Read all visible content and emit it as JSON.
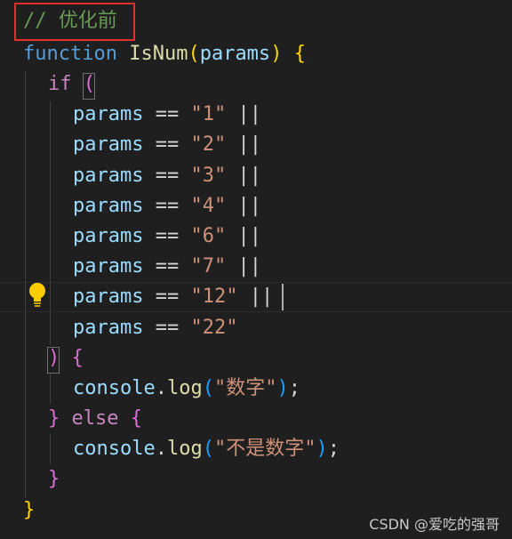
{
  "editor": {
    "lines": [
      {
        "segments": [
          [
            "cmt",
            "// 优化前"
          ]
        ]
      },
      {
        "segments": [
          [
            "kw",
            "function"
          ],
          [
            "op",
            " "
          ],
          [
            "fn",
            "IsNum"
          ],
          [
            "b1",
            "("
          ],
          [
            "var",
            "params"
          ],
          [
            "b1",
            ")"
          ],
          [
            "op",
            " "
          ],
          [
            "b1",
            "{"
          ]
        ]
      },
      {
        "segments": [
          [
            "ctl",
            "if"
          ],
          [
            "op",
            " "
          ],
          [
            "b2",
            "("
          ]
        ]
      },
      {
        "segments": [
          [
            "var",
            "params"
          ],
          [
            "op",
            " == "
          ],
          [
            "str",
            "\"1\""
          ],
          [
            "op",
            " ||"
          ]
        ]
      },
      {
        "segments": [
          [
            "var",
            "params"
          ],
          [
            "op",
            " == "
          ],
          [
            "str",
            "\"2\""
          ],
          [
            "op",
            " ||"
          ]
        ]
      },
      {
        "segments": [
          [
            "var",
            "params"
          ],
          [
            "op",
            " == "
          ],
          [
            "str",
            "\"3\""
          ],
          [
            "op",
            " ||"
          ]
        ]
      },
      {
        "segments": [
          [
            "var",
            "params"
          ],
          [
            "op",
            " == "
          ],
          [
            "str",
            "\"4\""
          ],
          [
            "op",
            " ||"
          ]
        ]
      },
      {
        "segments": [
          [
            "var",
            "params"
          ],
          [
            "op",
            " == "
          ],
          [
            "str",
            "\"6\""
          ],
          [
            "op",
            " ||"
          ]
        ]
      },
      {
        "segments": [
          [
            "var",
            "params"
          ],
          [
            "op",
            " == "
          ],
          [
            "str",
            "\"7\""
          ],
          [
            "op",
            " ||"
          ]
        ]
      },
      {
        "segments": [
          [
            "var",
            "params"
          ],
          [
            "op",
            " == "
          ],
          [
            "str",
            "\"12\""
          ],
          [
            "op",
            " ||"
          ]
        ]
      },
      {
        "segments": [
          [
            "var",
            "params"
          ],
          [
            "op",
            " == "
          ],
          [
            "str",
            "\"22\""
          ]
        ]
      },
      {
        "segments": [
          [
            "b2",
            ")"
          ],
          [
            "op",
            " "
          ],
          [
            "b2",
            "{"
          ]
        ]
      },
      {
        "segments": [
          [
            "var",
            "console"
          ],
          [
            "op",
            "."
          ],
          [
            "fn",
            "log"
          ],
          [
            "b3",
            "("
          ],
          [
            "str",
            "\"数字\""
          ],
          [
            "b3",
            ")"
          ],
          [
            "op",
            ";"
          ]
        ]
      },
      {
        "segments": [
          [
            "b2",
            "}"
          ],
          [
            "op",
            " "
          ],
          [
            "ctl",
            "else"
          ],
          [
            "op",
            " "
          ],
          [
            "b2",
            "{"
          ]
        ]
      },
      {
        "segments": [
          [
            "var",
            "console"
          ],
          [
            "op",
            "."
          ],
          [
            "fn",
            "log"
          ],
          [
            "b3",
            "("
          ],
          [
            "str",
            "\"不是数字\""
          ],
          [
            "b3",
            ")"
          ],
          [
            "op",
            ";"
          ]
        ]
      },
      {
        "segments": [
          [
            "b2",
            "}"
          ]
        ]
      },
      {
        "segments": [
          [
            "b1",
            "}"
          ]
        ]
      }
    ]
  },
  "colors": {
    "background": "#1f1f1f",
    "highlight_box": "#e0302a",
    "lightbulb": "#ffcc00"
  },
  "lightbulb_icon": "lightbulb-icon",
  "watermark": "CSDN @爱吃的强哥"
}
